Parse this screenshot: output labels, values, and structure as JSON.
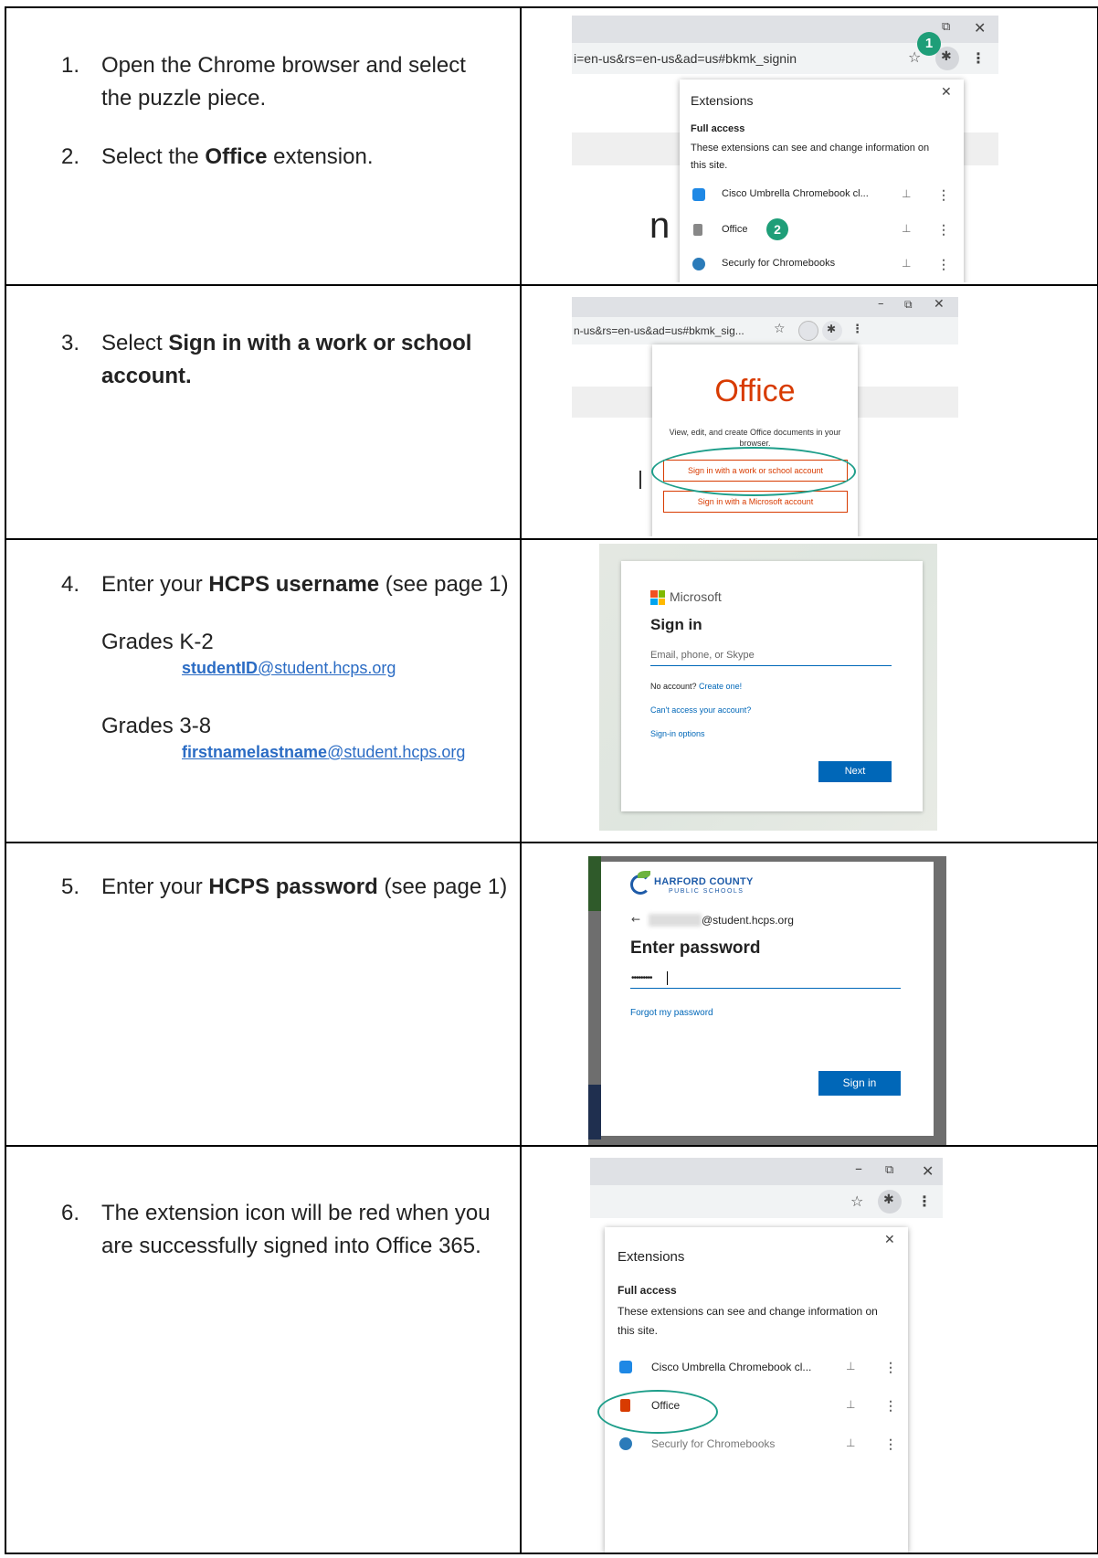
{
  "steps": {
    "s1": {
      "num": "1.",
      "text": "Open the Chrome browser and select the puzzle piece."
    },
    "s2": {
      "num": "2.",
      "pre": "Select the ",
      "bold": "Office",
      "post": " extension."
    },
    "s3": {
      "num": "3.",
      "pre": "Select ",
      "bold": "Sign in with a work or school account."
    },
    "s4": {
      "num": "4.",
      "pre": "Enter your ",
      "bold": "HCPS username",
      "post": " (see page 1)"
    },
    "s5": {
      "num": "5.",
      "pre": "Enter your ",
      "bold": "HCPS password",
      "post": " (see page 1)"
    },
    "s6": {
      "num": "6.",
      "text": "The extension icon will be red when you are successfully signed into Office 365."
    }
  },
  "grades": {
    "k2": {
      "label": "Grades K-2",
      "email_bold": "studentID",
      "email_rest": "@student.hcps.org"
    },
    "g38": {
      "label": "Grades 3-8",
      "email_bold": "firstnamelastname",
      "email_rest": "@student.hcps.org"
    }
  },
  "shot1": {
    "url": "i=en-us&rs=en-us&ad=us#bkmk_signin",
    "badge1": "1",
    "badge2": "2",
    "title": "Extensions",
    "section": "Full access",
    "desc": "These extensions can see and change information on this site.",
    "items": [
      "Cisco Umbrella Chromebook cl...",
      "Office",
      "Securly for Chromebooks"
    ],
    "bg_letter": "n"
  },
  "shot2": {
    "url": "n-us&rs=en-us&ad=us#bkmk_sig...",
    "brand": "Office",
    "desc": "View, edit, and create Office documents in your browser.",
    "btn_work": "Sign in with a work or school account",
    "btn_ms": "Sign in with a Microsoft account"
  },
  "shot3": {
    "brand": "Microsoft",
    "title": "Sign in",
    "placeholder": "Email, phone, or Skype",
    "no_account": "No account? ",
    "create": "Create one!",
    "cant_access": "Can't access your account?",
    "options": "Sign-in options",
    "next": "Next"
  },
  "shot4": {
    "logo_top": "HARFORD COUNTY",
    "logo_bottom": "PUBLIC SCHOOLS",
    "email_suffix": "@student.hcps.org",
    "title": "Enter password",
    "dots": "•••••••••",
    "forgot": "Forgot my password",
    "signin": "Sign in"
  },
  "shot5": {
    "title": "Extensions",
    "section": "Full access",
    "desc": "These extensions can see and change information on this site.",
    "items": [
      "Cisco Umbrella Chromebook cl...",
      "Office",
      "Securly for Chromebooks"
    ]
  },
  "colors": {
    "teal": "#1e9e8a",
    "office_red": "#d83b01",
    "ms_blue": "#0067b8"
  }
}
